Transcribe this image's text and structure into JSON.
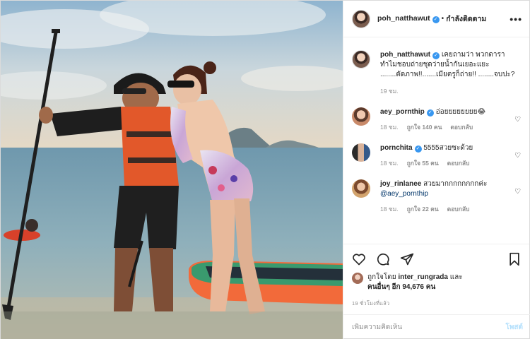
{
  "post": {
    "username": "poh_natthawut",
    "follow_label": "กำลังติดตาม",
    "more_label": "•••",
    "caption_line1": "เคยถามว่า พวกดารา",
    "caption_line2": "ทำไมชอบถ่ายชุดว่ายน้ำกันเยอะแยะ",
    "caption_line3": "........ตัดภาพ!!.......เมียตรูก็ถ่าย!! ........จบปะ?",
    "caption_time": "19 ชม."
  },
  "comments": [
    {
      "username": "aey_pornthip",
      "text": "อ่อยยยยยยยย😂",
      "time": "18 ชม.",
      "likes": "ถูกใจ 140 คน",
      "reply": "ตอบกลับ",
      "verified": true
    },
    {
      "username": "pornchita",
      "text": "5555สวยซะด้วย",
      "time": "18 ชม.",
      "likes": "ถูกใจ 55 คน",
      "reply": "ตอบกลับ",
      "verified": true
    },
    {
      "username": "joy_rinlanee",
      "text": "สวยมากกกกกกกกค่ะ",
      "mention": "@aey_pornthip",
      "time": "18 ชม.",
      "likes": "ถูกใจ 22 คน",
      "reply": "ตอบกลับ",
      "verified": false
    }
  ],
  "likes_section": {
    "liked_by_prefix": "ถูกใจโดย",
    "liked_by_user": "inter_rungrada",
    "and": "และ",
    "others": "คนอื่นๆ อีก 94,676 คน",
    "post_time": "19 ชั่วโมงที่แล้ว"
  },
  "add_comment": {
    "placeholder": "เพิ่มความคิดเห็น",
    "post_label": "โพสต์"
  },
  "icons": {
    "like": "heart-icon",
    "comment": "comment-icon",
    "share": "share-icon",
    "save": "bookmark-icon",
    "verified": "verified-badge-icon"
  },
  "colors": {
    "verified": "#3897f0",
    "link": "#003569",
    "muted": "#8e8e8e",
    "post_disabled": "#b2dffc"
  }
}
